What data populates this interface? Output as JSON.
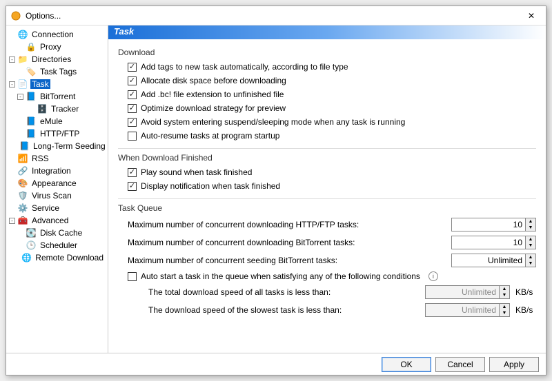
{
  "window": {
    "title": "Options...",
    "close_glyph": "✕"
  },
  "sidebar": {
    "items": [
      {
        "label": "Connection",
        "icon": "🌐",
        "indent": 0,
        "expander": ""
      },
      {
        "label": "Proxy",
        "icon": "🔒",
        "indent": 1,
        "expander": ""
      },
      {
        "label": "Directories",
        "icon": "📁",
        "indent": 0,
        "expander": "-"
      },
      {
        "label": "Task Tags",
        "icon": "🏷️",
        "indent": 1,
        "expander": ""
      },
      {
        "label": "Task",
        "icon": "📄",
        "indent": 0,
        "expander": "-",
        "selected": true
      },
      {
        "label": "BitTorrent",
        "icon": "📘",
        "indent": 1,
        "expander": "-"
      },
      {
        "label": "Tracker",
        "icon": "🗄️",
        "indent": 2,
        "expander": ""
      },
      {
        "label": "eMule",
        "icon": "📘",
        "indent": 1,
        "expander": ""
      },
      {
        "label": "HTTP/FTP",
        "icon": "📘",
        "indent": 1,
        "expander": ""
      },
      {
        "label": "Long-Term Seeding",
        "icon": "📘",
        "indent": 1,
        "expander": ""
      },
      {
        "label": "RSS",
        "icon": "📶",
        "indent": 0,
        "expander": ""
      },
      {
        "label": "Integration",
        "icon": "🔗",
        "indent": 0,
        "expander": ""
      },
      {
        "label": "Appearance",
        "icon": "🎨",
        "indent": 0,
        "expander": ""
      },
      {
        "label": "Virus Scan",
        "icon": "🛡️",
        "indent": 0,
        "expander": ""
      },
      {
        "label": "Service",
        "icon": "⚙️",
        "indent": 0,
        "expander": ""
      },
      {
        "label": "Advanced",
        "icon": "🧰",
        "indent": 0,
        "expander": "-"
      },
      {
        "label": "Disk Cache",
        "icon": "💽",
        "indent": 1,
        "expander": ""
      },
      {
        "label": "Scheduler",
        "icon": "🕒",
        "indent": 1,
        "expander": ""
      },
      {
        "label": "Remote Download",
        "icon": "🌐",
        "indent": 1,
        "expander": ""
      }
    ]
  },
  "content": {
    "banner": "Task",
    "section_download": "Download",
    "download_checks": [
      {
        "label": "Add tags to new task automatically, according to file type",
        "checked": true
      },
      {
        "label": "Allocate disk space before downloading",
        "checked": true
      },
      {
        "label": "Add .bc! file extension to unfinished file",
        "checked": true
      },
      {
        "label": "Optimize download strategy for preview",
        "checked": true
      },
      {
        "label": "Avoid system entering suspend/sleeping mode when any task is running",
        "checked": true
      },
      {
        "label": "Auto-resume tasks at program startup",
        "checked": false
      }
    ],
    "section_finished": "When Download Finished",
    "finished_checks": [
      {
        "label": "Play sound when task finished",
        "checked": true
      },
      {
        "label": "Display notification when task finished",
        "checked": true
      }
    ],
    "section_queue": "Task Queue",
    "queue_rows": [
      {
        "label": "Maximum number of concurrent downloading HTTP/FTP tasks:",
        "value": "10"
      },
      {
        "label": "Maximum number of concurrent downloading BitTorrent tasks:",
        "value": "10"
      },
      {
        "label": "Maximum number of concurrent seeding BitTorrent tasks:",
        "value": "Unlimited"
      }
    ],
    "autostart": {
      "label": "Auto start a task in the queue when satisfying any of the following conditions",
      "checked": false
    },
    "subrows": [
      {
        "label": "The total download speed of all tasks is less than:",
        "value": "Unlimited",
        "unit": "KB/s"
      },
      {
        "label": "The download speed of the slowest task is less than:",
        "value": "Unlimited",
        "unit": "KB/s"
      }
    ]
  },
  "footer": {
    "ok": "OK",
    "cancel": "Cancel",
    "apply": "Apply"
  },
  "colors": {
    "accent": "#1a6fd8",
    "selection": "#0a64c8"
  }
}
